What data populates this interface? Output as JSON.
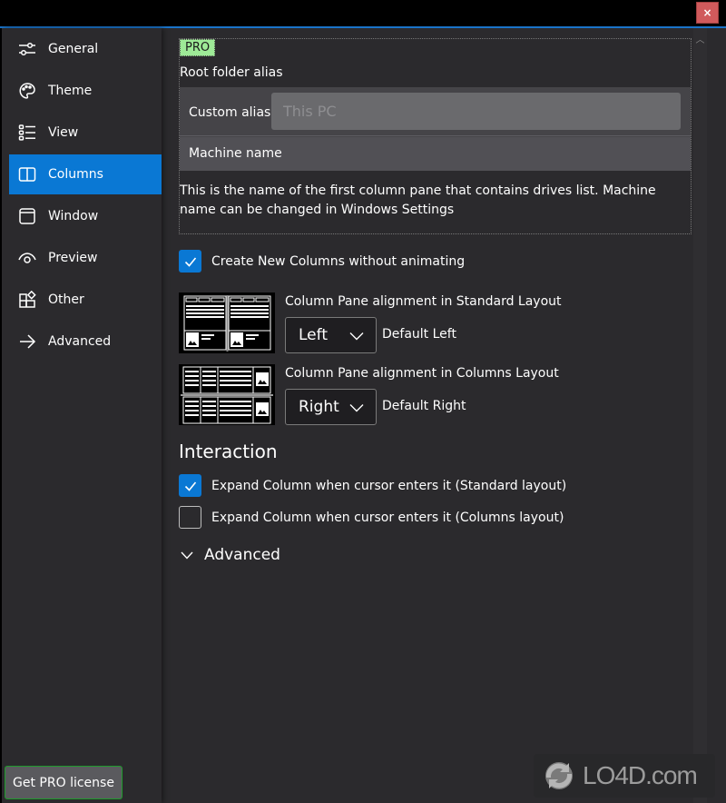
{
  "titlebar": {
    "close_icon": "×"
  },
  "sidebar": {
    "items": [
      {
        "label": "General",
        "icon": "sliders-icon",
        "active": false
      },
      {
        "label": "Theme",
        "icon": "palette-icon",
        "active": false
      },
      {
        "label": "View",
        "icon": "list-icon",
        "active": false
      },
      {
        "label": "Columns",
        "icon": "columns-icon",
        "active": true
      },
      {
        "label": "Window",
        "icon": "window-icon",
        "active": false
      },
      {
        "label": "Preview",
        "icon": "eye-icon",
        "active": false
      },
      {
        "label": "Other",
        "icon": "apps-icon",
        "active": false
      },
      {
        "label": "Advanced",
        "icon": "arrow-right-icon",
        "active": false
      }
    ],
    "pro_button_label": "Get PRO license"
  },
  "pro_group": {
    "badge": "PRO",
    "root_alias_label": "Root folder alias",
    "custom_alias_label": "Custom alias",
    "custom_alias_placeholder": "This PC",
    "custom_alias_value": "",
    "machine_name_label": "Machine name",
    "description": "This is the name of the first column pane that contains drives list. Machine name can be changed in Windows Settings"
  },
  "create_without_animating": {
    "label": "Create New Columns without animating",
    "checked": true
  },
  "standard_layout": {
    "title": "Column Pane alignment in Standard Layout",
    "value": "Left",
    "default_text": "Default Left"
  },
  "columns_layout": {
    "title": "Column Pane alignment in Columns Layout",
    "value": "Right",
    "default_text": "Default Right"
  },
  "interaction": {
    "heading": "Interaction",
    "options": [
      {
        "label": "Expand Column when cursor enters it (Standard layout)",
        "checked": true
      },
      {
        "label": "Expand Column when cursor enters it (Columns layout)",
        "checked": false
      }
    ]
  },
  "advanced_expander": {
    "label": "Advanced",
    "expanded": false
  },
  "watermark": {
    "text": "LO4D.com"
  },
  "colors": {
    "accent": "#0a78d4",
    "background": "#2b2a2d",
    "pro_badge": "#9eea97",
    "close_button": "#d05a5c",
    "pro_button_border": "#1e9b2b"
  }
}
